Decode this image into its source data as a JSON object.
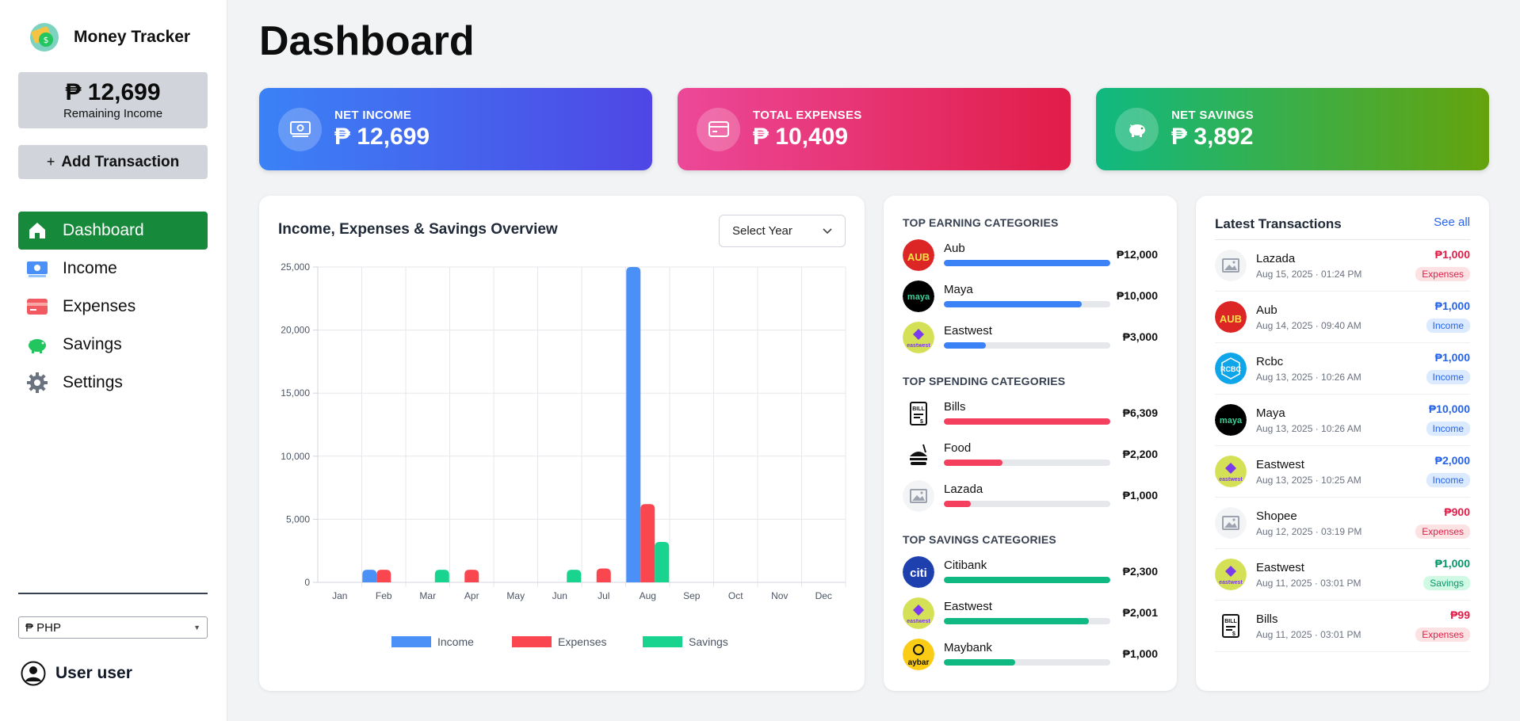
{
  "app": {
    "name": "Money Tracker"
  },
  "sidebar": {
    "balance_amount": "₱ 12,699",
    "balance_label": "Remaining Income",
    "add_label": "Add Transaction",
    "nav": [
      {
        "label": "Dashboard",
        "icon": "home-icon"
      },
      {
        "label": "Income",
        "icon": "cash-icon"
      },
      {
        "label": "Expenses",
        "icon": "credit-card-icon"
      },
      {
        "label": "Savings",
        "icon": "piggy-bank-icon"
      },
      {
        "label": "Settings",
        "icon": "gear-icon"
      }
    ],
    "currency": "₱ PHP",
    "user": "User user"
  },
  "page": {
    "title": "Dashboard"
  },
  "stats": {
    "net_income": {
      "label": "NET INCOME",
      "value": "₱ 12,699"
    },
    "total_expenses": {
      "label": "TOTAL EXPENSES",
      "value": "₱ 10,409"
    },
    "net_savings": {
      "label": "NET SAVINGS",
      "value": "₱ 3,892"
    }
  },
  "chart": {
    "title": "Income, Expenses & Savings Overview",
    "year_placeholder": "Select Year"
  },
  "chart_data": {
    "type": "bar",
    "categories": [
      "Jan",
      "Feb",
      "Mar",
      "Apr",
      "May",
      "Jun",
      "Jul",
      "Aug",
      "Sep",
      "Oct",
      "Nov",
      "Dec"
    ],
    "series": [
      {
        "name": "Income",
        "color": "#4a90f7",
        "values": [
          0,
          1000,
          0,
          0,
          0,
          0,
          0,
          25000,
          0,
          0,
          0,
          0
        ]
      },
      {
        "name": "Expenses",
        "color": "#f9464f",
        "values": [
          0,
          1000,
          0,
          1000,
          0,
          0,
          1100,
          6200,
          0,
          0,
          0,
          0
        ]
      },
      {
        "name": "Savings",
        "color": "#19d48f",
        "values": [
          0,
          0,
          1000,
          0,
          0,
          1000,
          0,
          3200,
          0,
          0,
          0,
          0
        ]
      }
    ],
    "ylim": [
      0,
      25000
    ],
    "yticks": [
      "0",
      "5,000",
      "10,000",
      "15,000",
      "20,000",
      "25,000"
    ],
    "grid": true,
    "legend": "bottom"
  },
  "categories": {
    "earning_heading": "TOP EARNING CATEGORIES",
    "earning": [
      {
        "name": "Aub",
        "amount": "₱12,000",
        "fraction": 1.0,
        "icon": "AUB",
        "bg": "#dc2626"
      },
      {
        "name": "Maya",
        "amount": "₱10,000",
        "fraction": 0.83,
        "icon": "maya",
        "bg": "#000000"
      },
      {
        "name": "Eastwest",
        "amount": "₱3,000",
        "fraction": 0.25,
        "icon": "ew",
        "bg": "#d4e157"
      }
    ],
    "spending_heading": "TOP SPENDING CATEGORIES",
    "spending": [
      {
        "name": "Bills",
        "amount": "₱6,309",
        "fraction": 1.0,
        "icon": "bills",
        "bg": "#ffffff"
      },
      {
        "name": "Food",
        "amount": "₱2,200",
        "fraction": 0.35,
        "icon": "food",
        "bg": "#ffffff"
      },
      {
        "name": "Lazada",
        "amount": "₱1,000",
        "fraction": 0.16,
        "icon": "img",
        "bg": "#f3f4f6"
      }
    ],
    "savings_heading": "TOP SAVINGS CATEGORIES",
    "savings": [
      {
        "name": "Citibank",
        "amount": "₱2,300",
        "fraction": 1.0,
        "icon": "citi",
        "bg": "#1e40af"
      },
      {
        "name": "Eastwest",
        "amount": "₱2,001",
        "fraction": 0.87,
        "icon": "ew",
        "bg": "#d4e157"
      },
      {
        "name": "Maybank",
        "amount": "₱1,000",
        "fraction": 0.43,
        "icon": "maybank",
        "bg": "#facc15"
      }
    ]
  },
  "transactions": {
    "title": "Latest Transactions",
    "see_all": "See all",
    "items": [
      {
        "name": "Lazada",
        "date": "Aug 15, 2025 · 01:24 PM",
        "amount": "₱1,000",
        "type": "Expenses",
        "icon": "img",
        "bg": "#f3f4f6"
      },
      {
        "name": "Aub",
        "date": "Aug 14, 2025 · 09:40 AM",
        "amount": "₱1,000",
        "type": "Income",
        "icon": "AUB",
        "bg": "#dc2626"
      },
      {
        "name": "Rcbc",
        "date": "Aug 13, 2025 · 10:26 AM",
        "amount": "₱1,000",
        "type": "Income",
        "icon": "RCBC",
        "bg": "#0ea5e9"
      },
      {
        "name": "Maya",
        "date": "Aug 13, 2025 · 10:26 AM",
        "amount": "₱10,000",
        "type": "Income",
        "icon": "maya",
        "bg": "#000000"
      },
      {
        "name": "Eastwest",
        "date": "Aug 13, 2025 · 10:25 AM",
        "amount": "₱2,000",
        "type": "Income",
        "icon": "ew",
        "bg": "#d4e157"
      },
      {
        "name": "Shopee",
        "date": "Aug 12, 2025 · 03:19 PM",
        "amount": "₱900",
        "type": "Expenses",
        "icon": "img",
        "bg": "#f3f4f6"
      },
      {
        "name": "Eastwest",
        "date": "Aug 11, 2025 · 03:01 PM",
        "amount": "₱1,000",
        "type": "Savings",
        "icon": "ew",
        "bg": "#d4e157"
      },
      {
        "name": "Bills",
        "date": "Aug 11, 2025 · 03:01 PM",
        "amount": "₱99",
        "type": "Expenses",
        "icon": "bills",
        "bg": "#ffffff"
      }
    ]
  }
}
